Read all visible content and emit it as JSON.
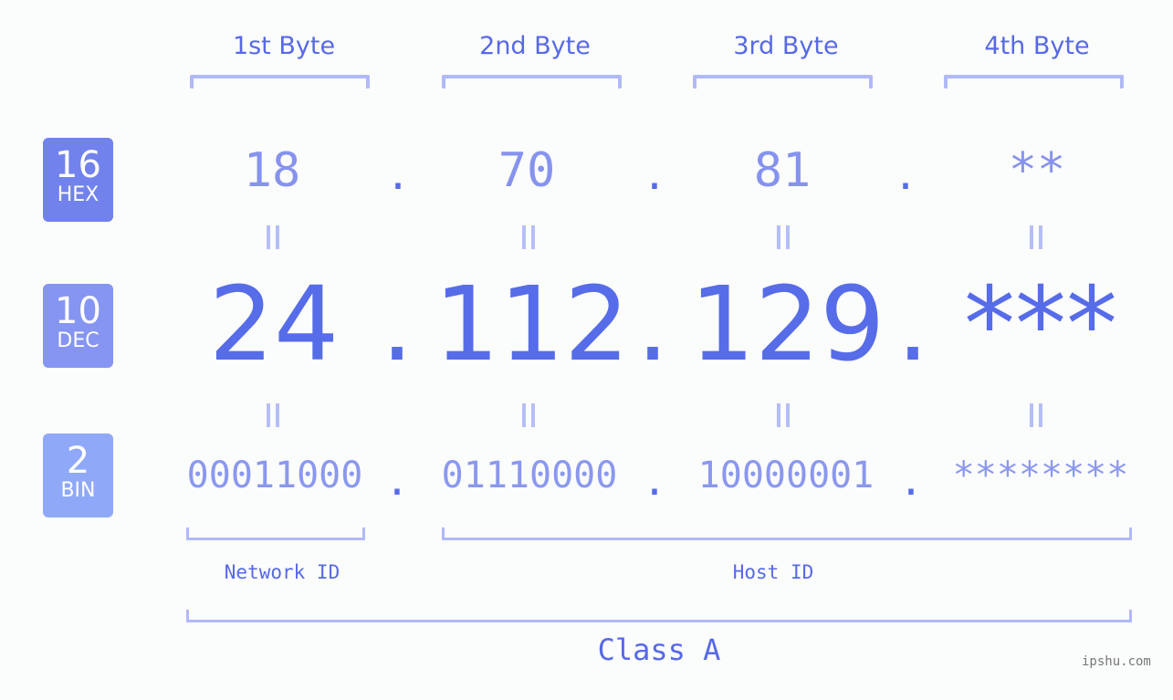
{
  "byte_headers": [
    "1st Byte",
    "2nd Byte",
    "3rd Byte",
    "4th Byte"
  ],
  "badges": [
    {
      "num": "16",
      "label": "HEX",
      "color": "#7282ec"
    },
    {
      "num": "10",
      "label": "DEC",
      "color": "#8595f1"
    },
    {
      "num": "2",
      "label": "BIN",
      "color": "#90a8f8"
    }
  ],
  "hex": [
    "18",
    "70",
    "81",
    "**"
  ],
  "dec": [
    "24",
    "112",
    "129",
    "***"
  ],
  "bin": [
    "00011000",
    "01110000",
    "10000001",
    "********"
  ],
  "separator": ".",
  "equals_sign": "=",
  "network_label": "Network ID",
  "host_label": "Host ID",
  "class_label": "Class A",
  "watermark": "ipshu.com",
  "colors": {
    "accent": "#566ce8",
    "bracket": "#b1b9f7",
    "background": "#fbfcfc"
  }
}
